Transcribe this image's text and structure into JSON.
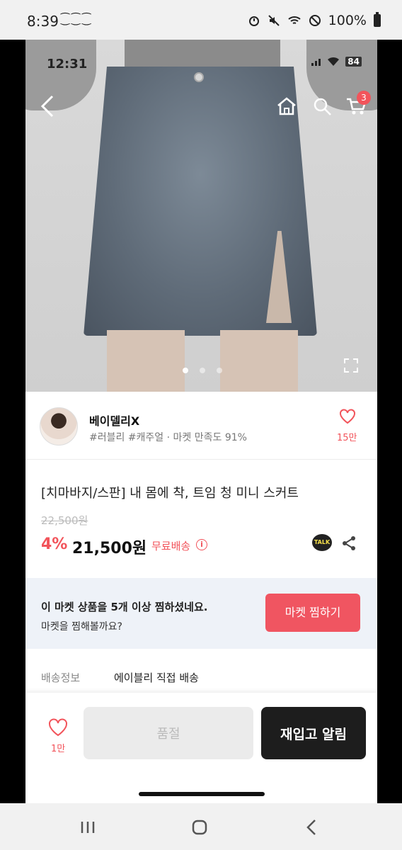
{
  "os_status": {
    "time": "8:39",
    "notifications": "⁐⁐⁐",
    "battery": "100%"
  },
  "app_status": {
    "time": "12:31",
    "battery": "84"
  },
  "nav": {
    "cart_count": "3"
  },
  "seller": {
    "name": "베이델리X",
    "tags": "#러블리 #캐주얼 · 마켓 만족도 91%",
    "likes": "15만"
  },
  "product": {
    "title": "[치마바지/스판] 내 몸에 착, 트임 청 미니 스커트",
    "original_price": "22,500원",
    "discount": "4%",
    "price": "21,500원",
    "shipping": "무료배송",
    "info_glyph": "i",
    "talk_label": "TALK"
  },
  "banner": {
    "line1": "이 마켓 상품을 5개 이상 찜하셨네요.",
    "line2": "마켓을 찜해볼까요?",
    "button": "마켓 찜하기"
  },
  "delivery": {
    "label": "배송정보",
    "value": "에이블리 직접 배송"
  },
  "bottom_bar": {
    "likes": "1만",
    "soldout": "품절",
    "restock": "재입고 알림"
  },
  "colors": {
    "accent": "#f2545b",
    "banner_bg": "#eef2f8",
    "restock_bg": "#1d1d1d"
  }
}
